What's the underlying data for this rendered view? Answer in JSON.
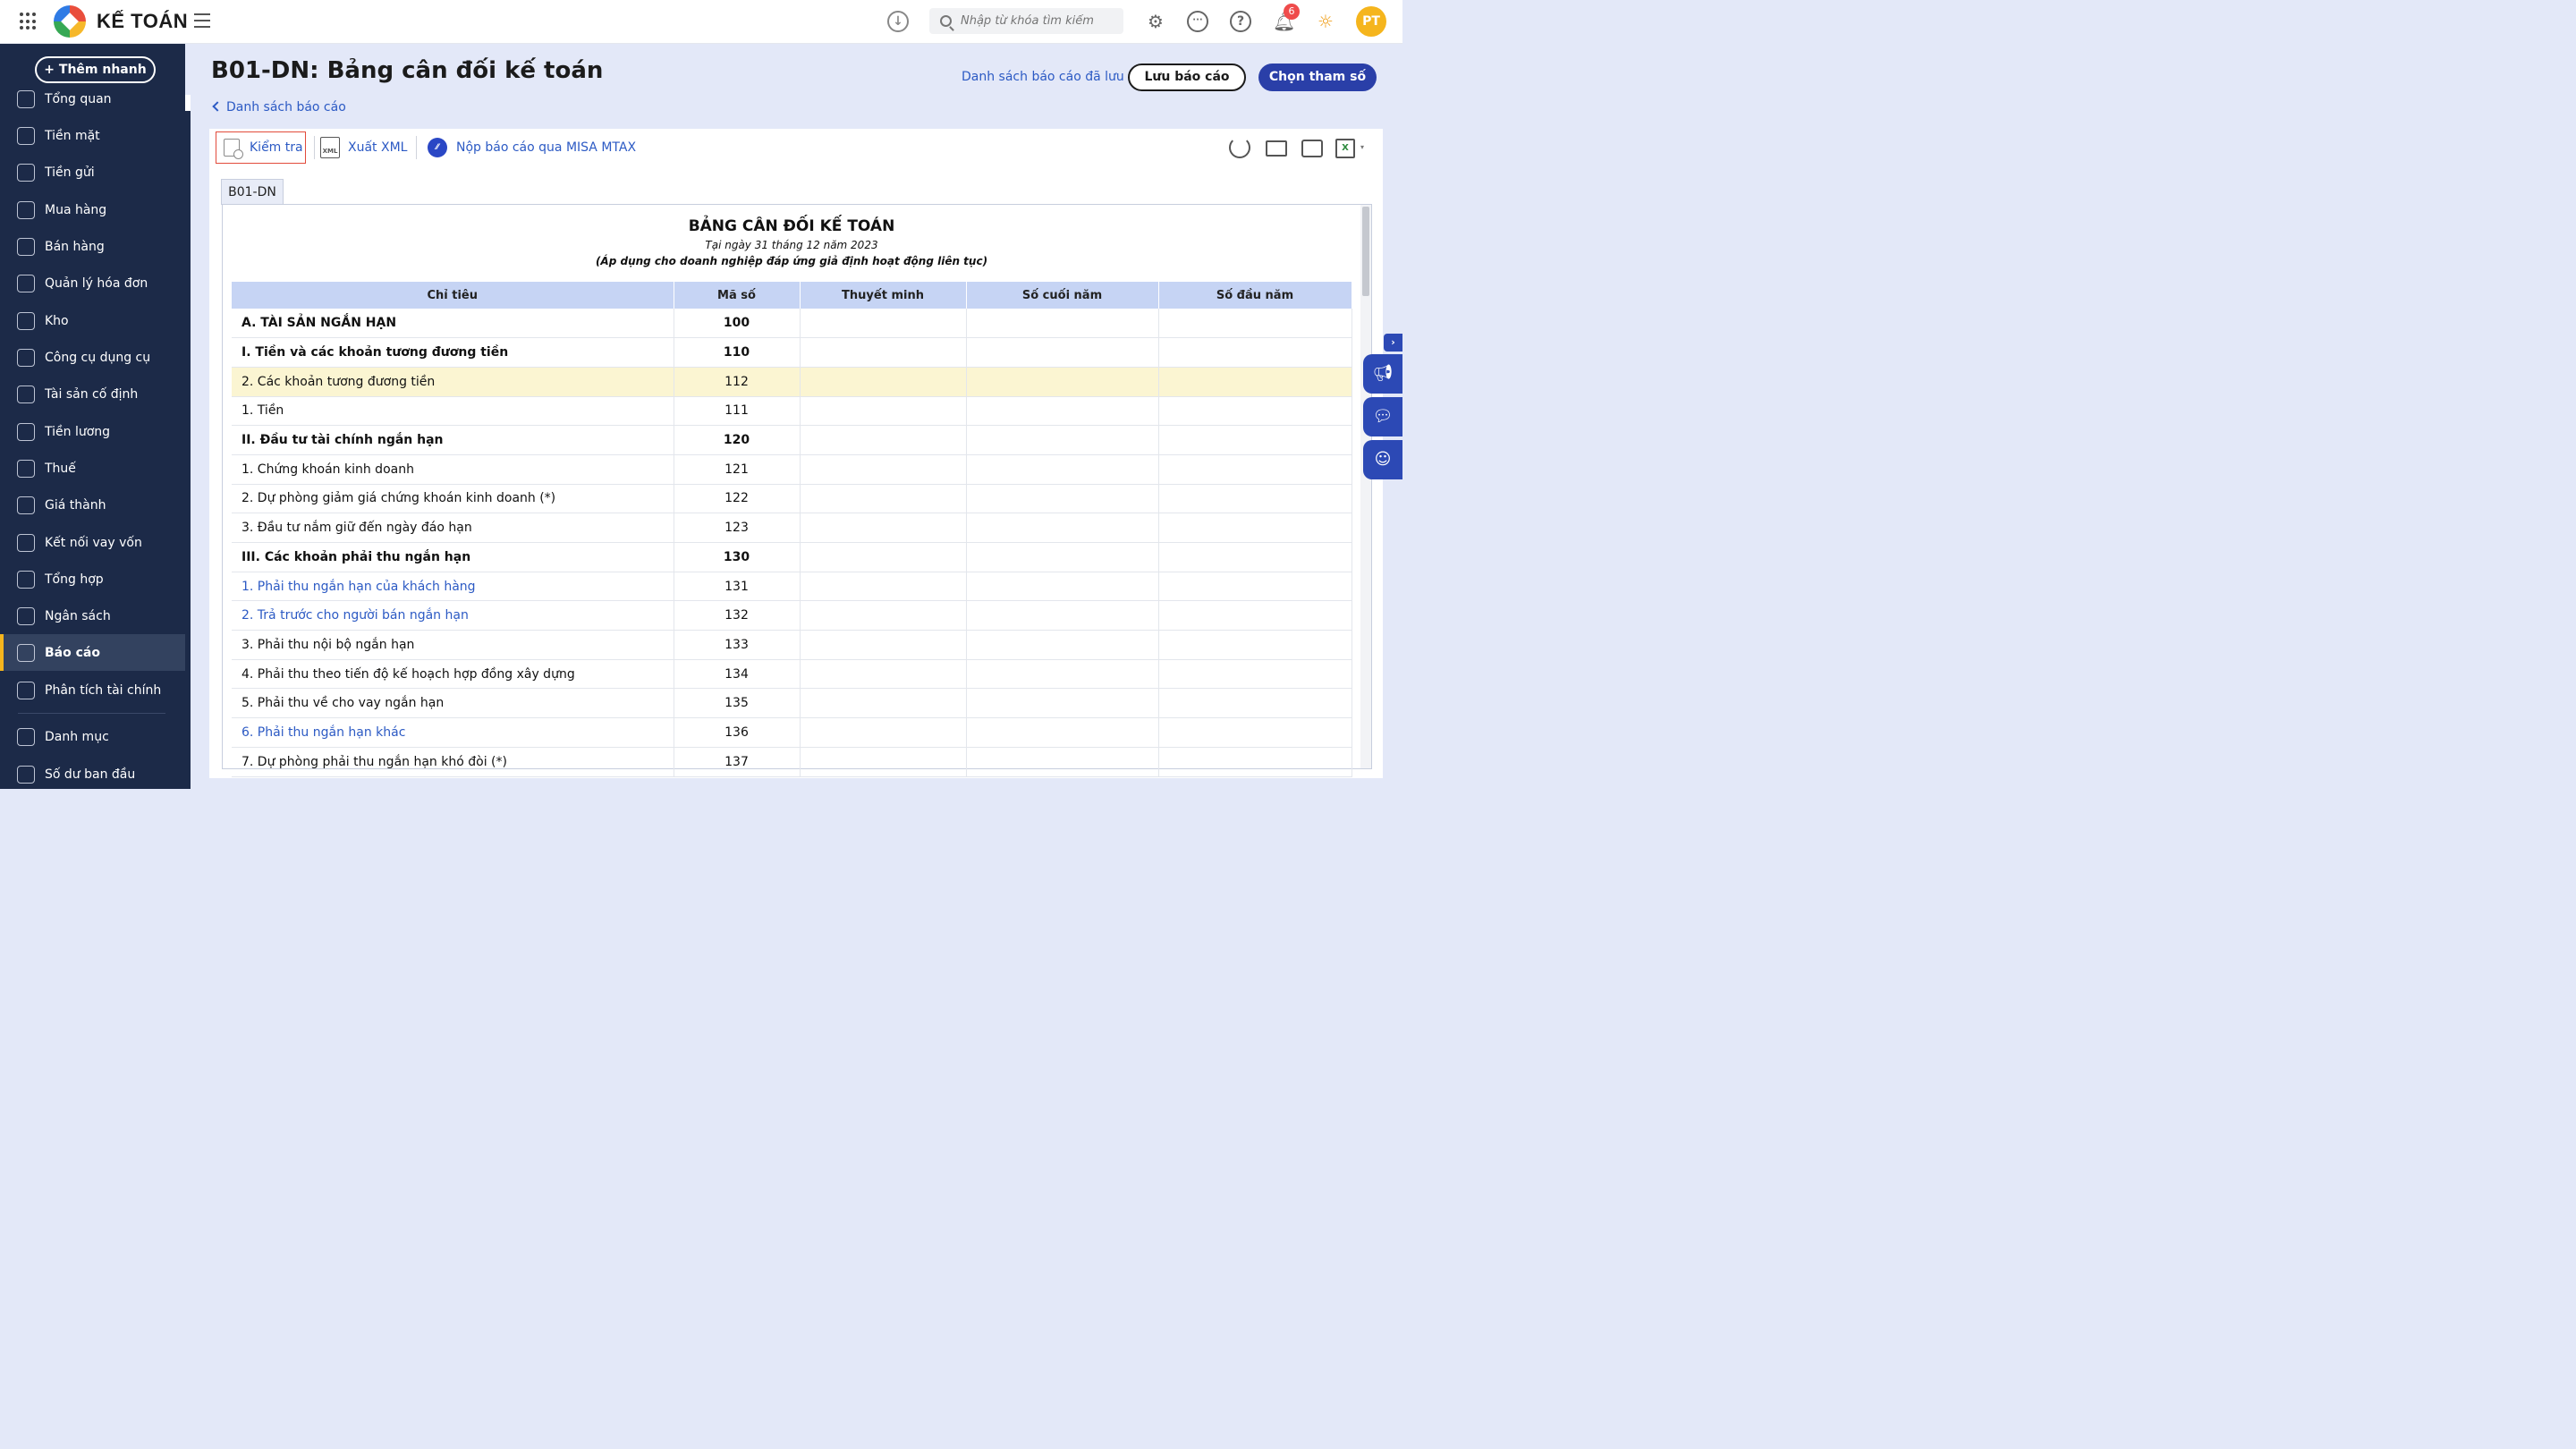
{
  "topbar": {
    "brand": "KẾ TOÁN",
    "search_placeholder": "Nhập từ khóa tìm kiếm",
    "notification_count": "6",
    "avatar_initials": "PT"
  },
  "sidebar": {
    "quick_add": "+ Thêm nhanh",
    "items": [
      {
        "label": "Tổng quan",
        "icon": "dashboard-icon"
      },
      {
        "label": "Tiền mặt",
        "icon": "cash-icon"
      },
      {
        "label": "Tiền gửi",
        "icon": "bank-icon"
      },
      {
        "label": "Mua hàng",
        "icon": "bag-icon"
      },
      {
        "label": "Bán hàng",
        "icon": "cart-icon"
      },
      {
        "label": "Quản lý hóa đơn",
        "icon": "invoice-icon"
      },
      {
        "label": "Kho",
        "icon": "warehouse-icon"
      },
      {
        "label": "Công cụ dụng cụ",
        "icon": "tools-icon"
      },
      {
        "label": "Tài sản cố định",
        "icon": "asset-icon"
      },
      {
        "label": "Tiền lương",
        "icon": "salary-icon"
      },
      {
        "label": "Thuế",
        "icon": "tax-icon"
      },
      {
        "label": "Giá thành",
        "icon": "price-tag-icon"
      },
      {
        "label": "Kết nối vay vốn",
        "icon": "loan-icon"
      },
      {
        "label": "Tổng hợp",
        "icon": "summary-icon"
      },
      {
        "label": "Ngân sách",
        "icon": "budget-icon"
      },
      {
        "label": "Báo cáo",
        "icon": "chart-icon"
      },
      {
        "label": "Phân tích tài chính",
        "icon": "analysis-icon"
      },
      {
        "label": "Danh mục",
        "icon": "list-icon"
      },
      {
        "label": "Số dư ban đầu",
        "icon": "balance-icon"
      }
    ]
  },
  "header": {
    "title": "B01-DN: Bảng cân đối kế toán",
    "saved_reports_link": "Danh sách báo cáo đã lưu",
    "save_button": "Lưu báo cáo",
    "params_button": "Chọn tham số",
    "back_link": "Danh sách báo cáo"
  },
  "toolbar": {
    "check": "Kiểm tra",
    "export_xml": "Xuất XML",
    "submit_mtax": "Nộp báo cáo qua MISA MTAX",
    "xml_icon_text": "XML"
  },
  "report": {
    "tab": "B01-DN",
    "title": "BẢNG CÂN ĐỐI KẾ TOÁN",
    "date_line": "Tại ngày 31 tháng 12 năm 2023",
    "scope_line": "(Áp dụng cho doanh nghiệp đáp ứng giả định hoạt động liên tục)",
    "columns": [
      "Chỉ tiêu",
      "Mã số",
      "Thuyết minh",
      "Số cuối năm",
      "Số đầu năm"
    ],
    "rows": [
      {
        "label": "A. TÀI SẢN NGẮN HẠN",
        "code": "100",
        "style": "bold"
      },
      {
        "label": "I. Tiền và các khoản tương đương tiền",
        "code": "110",
        "style": "bold"
      },
      {
        "label": "2. Các khoản tương đương tiền",
        "code": "112",
        "style": "highlight"
      },
      {
        "label": "1. Tiền",
        "code": "111",
        "style": ""
      },
      {
        "label": "II. Đầu tư tài chính ngắn hạn",
        "code": "120",
        "style": "bold"
      },
      {
        "label": "1. Chứng khoán kinh doanh",
        "code": "121",
        "style": ""
      },
      {
        "label": "2. Dự phòng giảm giá chứng khoán kinh doanh (*)",
        "code": "122",
        "style": ""
      },
      {
        "label": "3. Đầu tư nắm giữ đến ngày đáo hạn",
        "code": "123",
        "style": ""
      },
      {
        "label": "III. Các khoản phải thu ngắn hạn",
        "code": "130",
        "style": "bold"
      },
      {
        "label": "1. Phải thu ngắn hạn của khách hàng",
        "code": "131",
        "style": "link"
      },
      {
        "label": "2. Trả trước cho người bán ngắn hạn",
        "code": "132",
        "style": "link"
      },
      {
        "label": "3. Phải thu nội bộ ngắn hạn",
        "code": "133",
        "style": ""
      },
      {
        "label": "4. Phải thu theo tiến độ kế hoạch hợp đồng xây dựng",
        "code": "134",
        "style": ""
      },
      {
        "label": "5. Phải thu về cho vay ngắn hạn",
        "code": "135",
        "style": ""
      },
      {
        "label": "6. Phải thu ngắn hạn khác",
        "code": "136",
        "style": "link"
      },
      {
        "label": "7. Dự phòng phải thu ngắn hạn khó đòi (*)",
        "code": "137",
        "style": ""
      }
    ]
  },
  "colors": {
    "sidebar_bg": "#1c2a48",
    "primary": "#2a3fa8",
    "link": "#2c5ac4",
    "highlight_row": "#fbf5d2",
    "table_header": "#c6d4f4"
  }
}
